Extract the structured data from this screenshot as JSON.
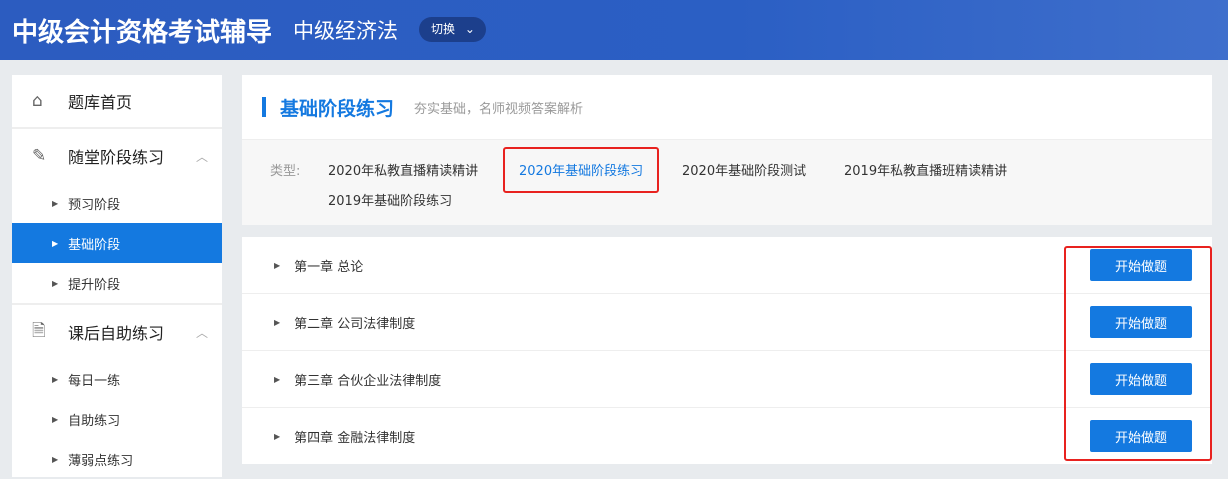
{
  "header": {
    "brand": "中级会计资格考试辅导",
    "subject": "中级经济法",
    "switch_label": "切换",
    "switch_icon": "chevron-down-icon"
  },
  "sidebar": {
    "home": "题库首页",
    "groups": [
      {
        "label": "随堂阶段练习",
        "items": [
          "预习阶段",
          "基础阶段",
          "提升阶段"
        ],
        "active": 1
      },
      {
        "label": "课后自助练习",
        "items": [
          "每日一练",
          "自助练习",
          "薄弱点练习"
        ]
      }
    ]
  },
  "section": {
    "title": "基础阶段练习",
    "desc": "夯实基础，名师视频答案解析",
    "type_label": "类型:",
    "types": [
      "2020年私教直播精读精讲",
      "2020年基础阶段练习",
      "2020年基础阶段测试",
      "2019年私教直播班精读精讲",
      "2019年基础阶段练习"
    ],
    "selected_type": 1
  },
  "chapters": [
    {
      "title": "第一章 总论",
      "button": "开始做题"
    },
    {
      "title": "第二章 公司法律制度",
      "button": "开始做题"
    },
    {
      "title": "第三章 合伙企业法律制度",
      "button": "开始做题"
    },
    {
      "title": "第四章 金融法律制度",
      "button": "开始做题"
    }
  ],
  "colors": {
    "accent": "#1479e0",
    "highlight": "#e8221f"
  }
}
